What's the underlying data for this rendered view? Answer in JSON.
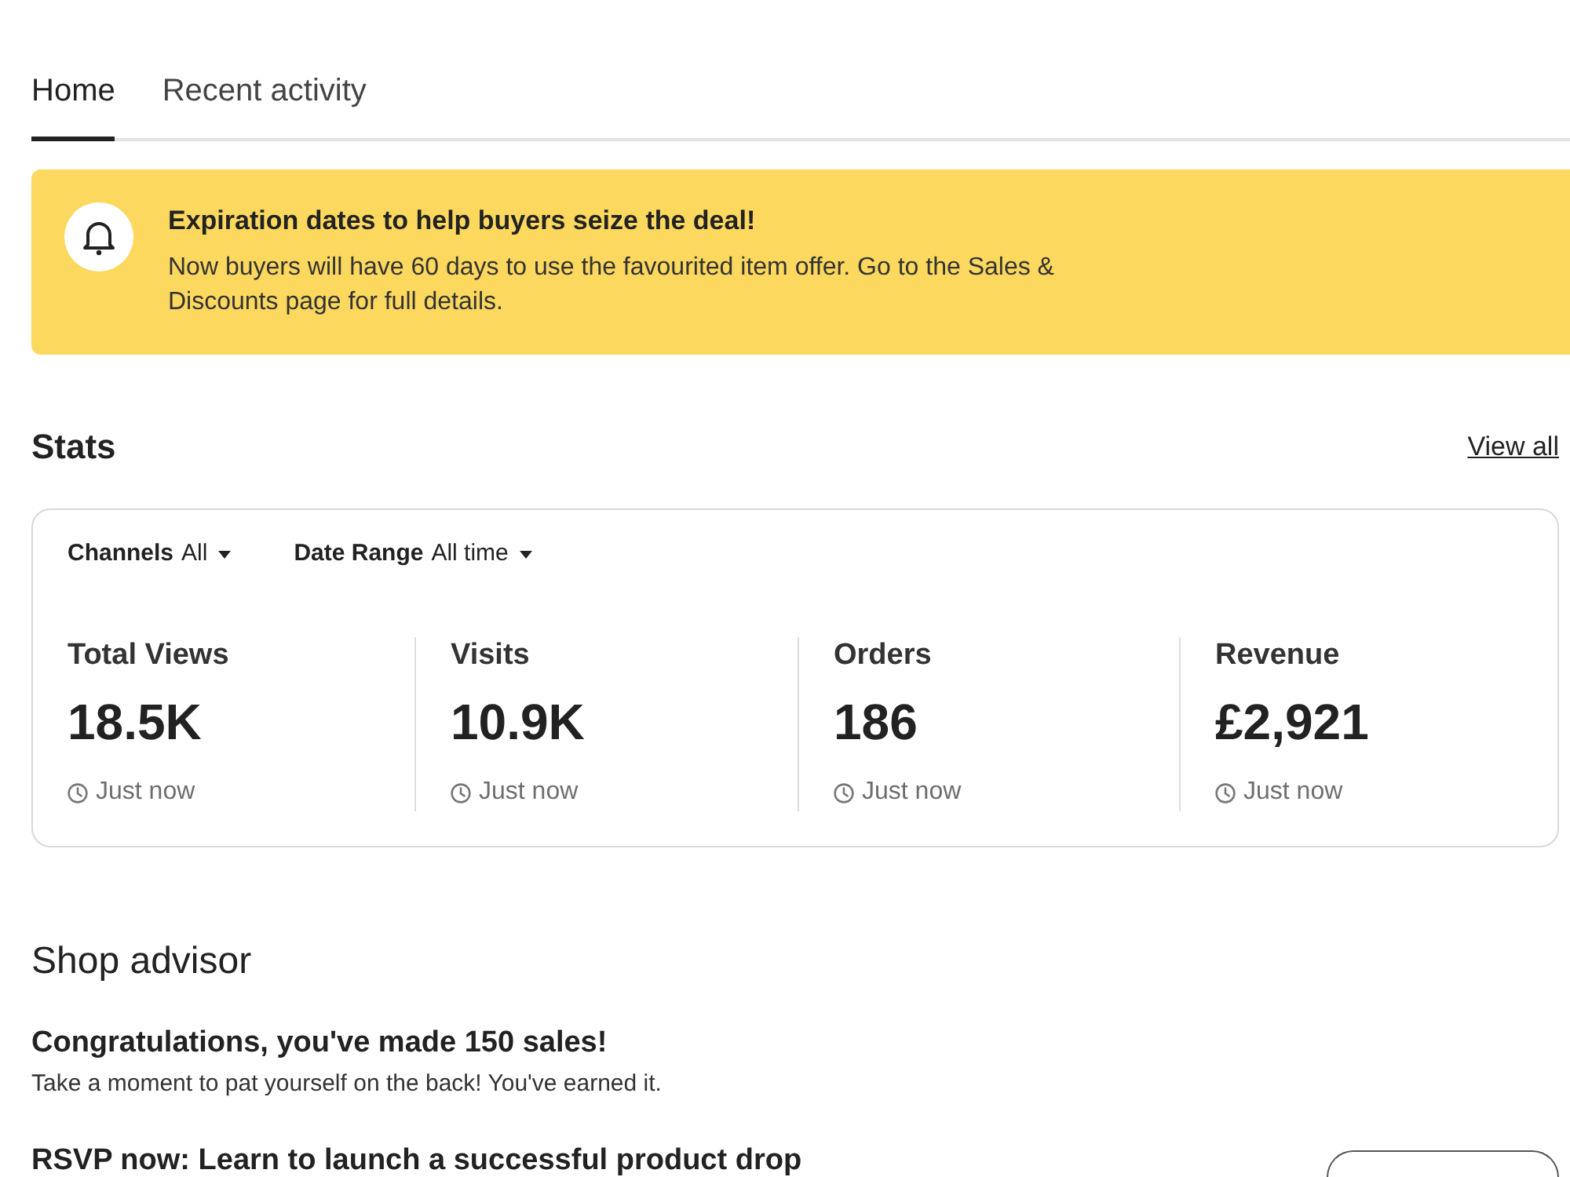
{
  "tabs": [
    {
      "label": "Home",
      "selected": true
    },
    {
      "label": "Recent activity",
      "selected": false
    }
  ],
  "banner": {
    "title": "Expiration dates to help buyers seize the deal!",
    "body": "Now buyers will have 60 days to use the favourited item offer. Go to the Sales & Discounts page for full details."
  },
  "stats": {
    "heading": "Stats",
    "link": "View all",
    "filters": [
      {
        "label": "Channels",
        "value": "All"
      },
      {
        "label": "Date Range",
        "value": "All time"
      }
    ],
    "metrics": [
      {
        "label": "Total Views",
        "value": "18.5K",
        "updated": "Just now"
      },
      {
        "label": "Visits",
        "value": "10.9K",
        "updated": "Just now"
      },
      {
        "label": "Orders",
        "value": "186",
        "updated": "Just now"
      },
      {
        "label": "Revenue",
        "value": "£2,921",
        "updated": "Just now"
      }
    ]
  },
  "shop_advisor": {
    "heading": "Shop advisor",
    "items": [
      {
        "kind": "note",
        "title": "Congratulations, you've made 150 sales!",
        "text": "Take a moment to pat yourself on the back! You've earned it."
      },
      {
        "kind": "action",
        "title": "RSVP now: Learn to launch a successful product drop"
      }
    ]
  }
}
